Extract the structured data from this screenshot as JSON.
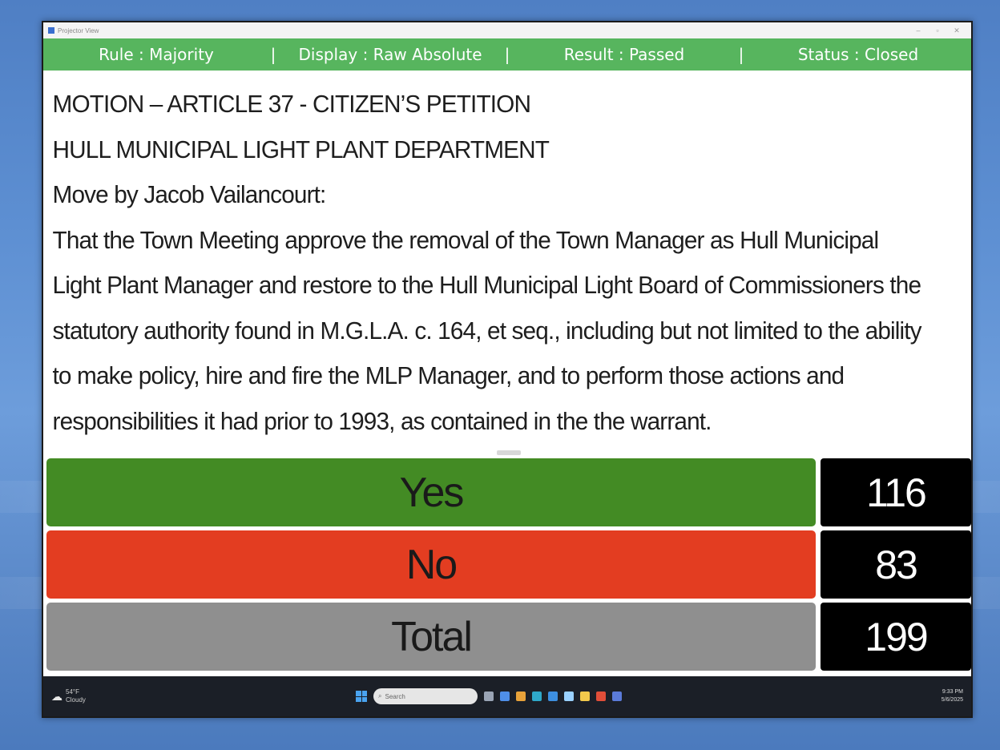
{
  "window": {
    "title": "Projector View"
  },
  "status": {
    "rule": "Rule : Majority",
    "display": "Raw Absolute",
    "display_prefix": "Display : ",
    "result": "Result : Passed",
    "status": "Status : Closed",
    "separator": "|"
  },
  "motion": {
    "line1": "MOTION – ARTICLE 37 - CITIZEN’S PETITION",
    "line2": "HULL MUNICIPAL LIGHT PLANT DEPARTMENT",
    "line3": "Move by Jacob Vailancourt:",
    "body": "That the Town Meeting approve the removal of the Town Manager as Hull Municipal Light Plant Manager and restore to the Hull Municipal Light Board of Commissioners the statutory authority found in M.G.L.A. c. 164, et seq., including but not limited to the ability to make policy, hire and fire the MLP Manager, and to perform those actions and responsibilities it had prior to 1993, as contained in the the warrant."
  },
  "votes": [
    {
      "label": "Yes",
      "count": "116",
      "color": "#438b24"
    },
    {
      "label": "No",
      "count": "83",
      "color": "#e33d21"
    },
    {
      "label": "Total",
      "count": "199",
      "color": "#8f8f8f"
    }
  ],
  "colors": {
    "status_bar": "#57b55e",
    "count_bg": "#000000"
  },
  "taskbar": {
    "weather_temp": "54°F",
    "weather_desc": "Cloudy",
    "search_placeholder": "Search",
    "time": "9:33 PM",
    "date": "5/6/2025"
  }
}
